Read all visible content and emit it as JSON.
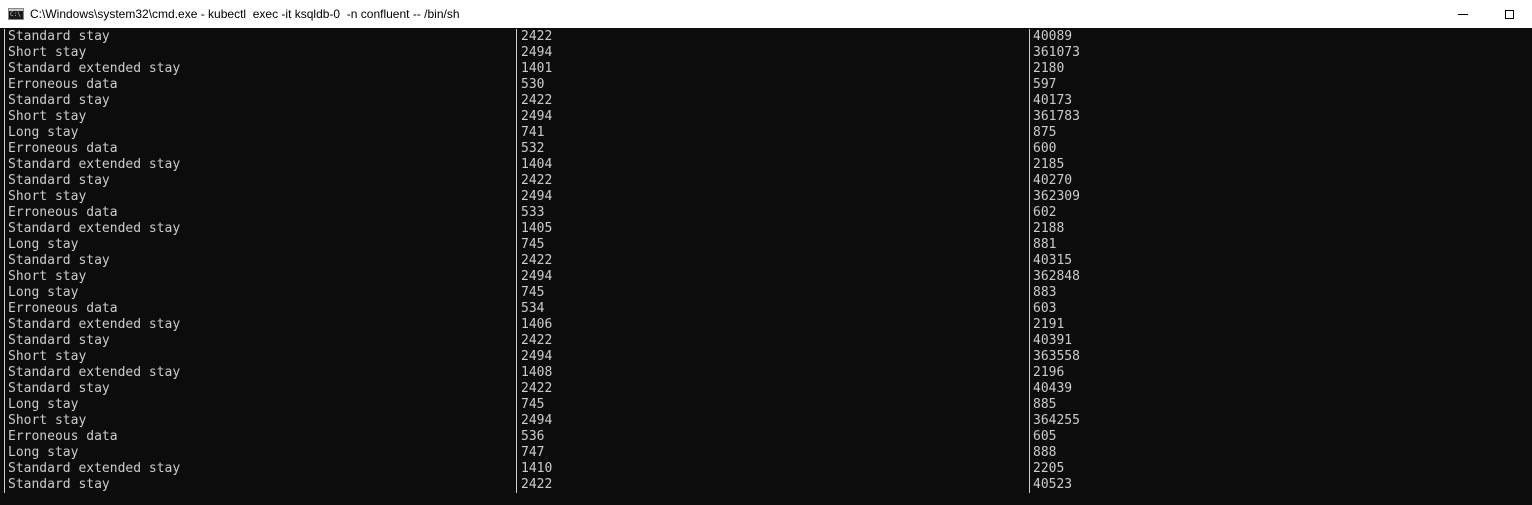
{
  "window": {
    "title": "C:\\Windows\\system32\\cmd.exe - kubectl  exec -it ksqldb-0  -n confluent -- /bin/sh",
    "icon_label": "C:\\"
  },
  "colors": {
    "console_background": "#0c0c0c",
    "console_text": "#cccccc",
    "titlebar_background": "#ffffff"
  },
  "rows": [
    {
      "type": "Standard stay",
      "count": "2422",
      "total": "40089"
    },
    {
      "type": "Short stay",
      "count": "2494",
      "total": "361073"
    },
    {
      "type": "Standard extended stay",
      "count": "1401",
      "total": "2180"
    },
    {
      "type": "Erroneous data",
      "count": "530",
      "total": "597"
    },
    {
      "type": "Standard stay",
      "count": "2422",
      "total": "40173"
    },
    {
      "type": "Short stay",
      "count": "2494",
      "total": "361783"
    },
    {
      "type": "Long stay",
      "count": "741",
      "total": "875"
    },
    {
      "type": "Erroneous data",
      "count": "532",
      "total": "600"
    },
    {
      "type": "Standard extended stay",
      "count": "1404",
      "total": "2185"
    },
    {
      "type": "Standard stay",
      "count": "2422",
      "total": "40270"
    },
    {
      "type": "Short stay",
      "count": "2494",
      "total": "362309"
    },
    {
      "type": "Erroneous data",
      "count": "533",
      "total": "602"
    },
    {
      "type": "Standard extended stay",
      "count": "1405",
      "total": "2188"
    },
    {
      "type": "Long stay",
      "count": "745",
      "total": "881"
    },
    {
      "type": "Standard stay",
      "count": "2422",
      "total": "40315"
    },
    {
      "type": "Short stay",
      "count": "2494",
      "total": "362848"
    },
    {
      "type": "Long stay",
      "count": "745",
      "total": "883"
    },
    {
      "type": "Erroneous data",
      "count": "534",
      "total": "603"
    },
    {
      "type": "Standard extended stay",
      "count": "1406",
      "total": "2191"
    },
    {
      "type": "Standard stay",
      "count": "2422",
      "total": "40391"
    },
    {
      "type": "Short stay",
      "count": "2494",
      "total": "363558"
    },
    {
      "type": "Standard extended stay",
      "count": "1408",
      "total": "2196"
    },
    {
      "type": "Standard stay",
      "count": "2422",
      "total": "40439"
    },
    {
      "type": "Long stay",
      "count": "745",
      "total": "885"
    },
    {
      "type": "Short stay",
      "count": "2494",
      "total": "364255"
    },
    {
      "type": "Erroneous data",
      "count": "536",
      "total": "605"
    },
    {
      "type": "Long stay",
      "count": "747",
      "total": "888"
    },
    {
      "type": "Standard extended stay",
      "count": "1410",
      "total": "2205"
    },
    {
      "type": "Standard stay",
      "count": "2422",
      "total": "40523"
    }
  ]
}
